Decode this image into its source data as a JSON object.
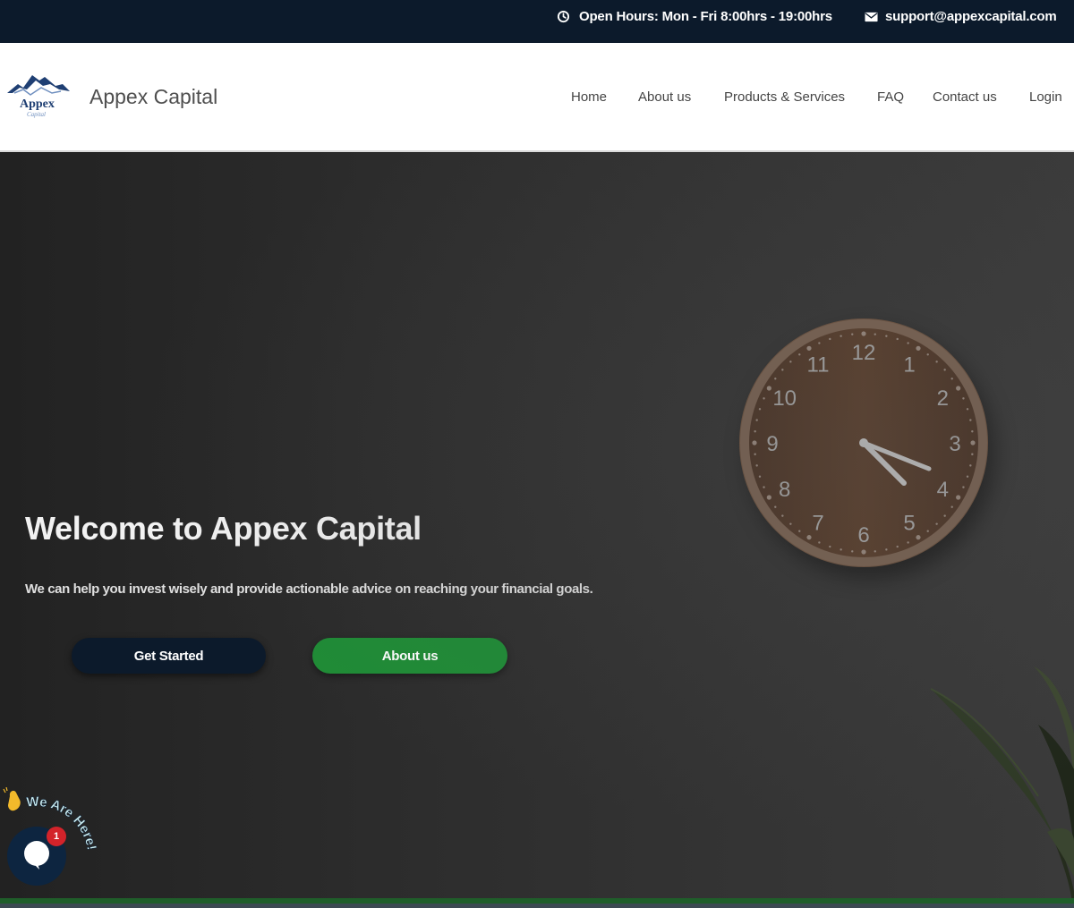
{
  "topbar": {
    "hours_icon": "clock-icon",
    "hours_text": "Open Hours: Mon - Fri 8:00hrs - 19:00hrs",
    "email_icon": "envelope-icon",
    "email_text": "support@appexcapital.com"
  },
  "header": {
    "logo_icon": "mountain-logo-icon",
    "logo_text": "Appex",
    "logo_subtext": "Capital",
    "brand_name": "Appex Capital",
    "nav": [
      {
        "label": "Home"
      },
      {
        "label": "About us"
      },
      {
        "label": "Products & Services"
      },
      {
        "label": "FAQ"
      },
      {
        "label": "Contact us"
      },
      {
        "label": "Login"
      }
    ]
  },
  "hero": {
    "title": "Welcome to Appex Capital",
    "subtitle": "We can help you invest wisely and provide actionable advice on reaching your financial goals.",
    "buttons": {
      "get_started": "Get Started",
      "about_us": "About us"
    },
    "clock_numbers": [
      "12",
      "1",
      "2",
      "3",
      "4",
      "5",
      "6",
      "7",
      "8",
      "9",
      "10",
      "11"
    ]
  },
  "chat": {
    "label": "We Are Here!",
    "hand_icon": "waving-hand-icon",
    "bubble_icon": "chat-bubble-icon",
    "badge_count": "1"
  },
  "colors": {
    "topbar_bg": "#0c1a2b",
    "primary_button": "#0c1a2b",
    "secondary_button": "#1f8c36",
    "badge": "#d3232a"
  }
}
